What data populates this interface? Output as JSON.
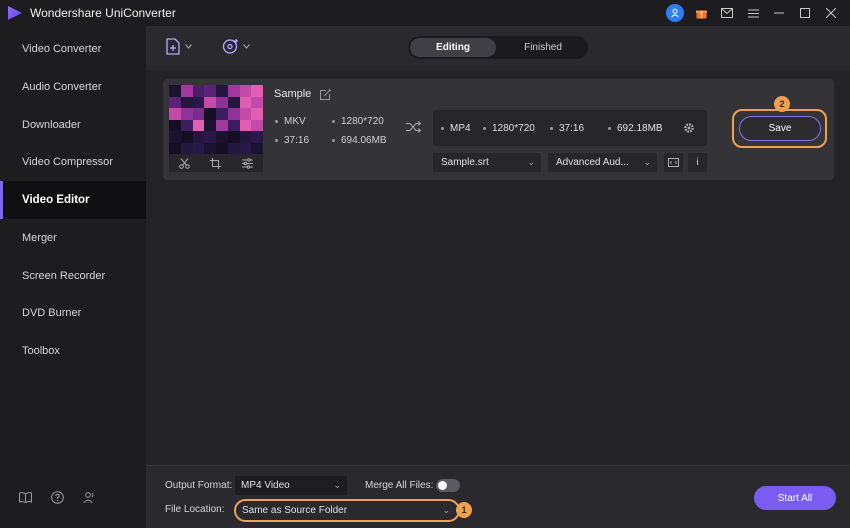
{
  "app": {
    "title": "Wondershare UniConverter"
  },
  "titlebar": {
    "icons": [
      "user-icon",
      "gift-icon",
      "mail-icon",
      "menu-icon",
      "minimize-icon",
      "maximize-icon",
      "close-icon"
    ]
  },
  "sidebar": {
    "items": [
      {
        "label": "Video Converter",
        "active": false
      },
      {
        "label": "Audio Converter",
        "active": false
      },
      {
        "label": "Downloader",
        "active": false
      },
      {
        "label": "Video Compressor",
        "active": false
      },
      {
        "label": "Video Editor",
        "active": true
      },
      {
        "label": "Merger",
        "active": false
      },
      {
        "label": "Screen Recorder",
        "active": false
      },
      {
        "label": "DVD Burner",
        "active": false
      },
      {
        "label": "Toolbox",
        "active": false
      }
    ],
    "footer_icons": [
      "book-icon",
      "help-icon",
      "account-icon"
    ]
  },
  "header": {
    "tabs": [
      {
        "label": "Editing",
        "active": true
      },
      {
        "label": "Finished",
        "active": false
      }
    ]
  },
  "task": {
    "file_name": "Sample",
    "source": {
      "format": "MKV",
      "resolution": "1280*720",
      "duration": "37:16",
      "size": "694.06MB"
    },
    "target": {
      "format": "MP4",
      "resolution": "1280*720",
      "duration": "37:16",
      "size": "692.18MB"
    },
    "subtitle": "Sample.srt",
    "audio": "Advanced Aud...",
    "save_label": "Save",
    "save_badge": "2"
  },
  "bottom": {
    "output_format_label": "Output Format:",
    "output_format_value": "MP4 Video",
    "merge_label": "Merge All Files:",
    "merge_enabled": false,
    "file_location_label": "File Location:",
    "file_location_value": "Same as Source Folder",
    "location_badge": "1",
    "start_all_label": "Start All"
  },
  "colors": {
    "accent": "#7a5cf0",
    "highlight": "#f0a050",
    "sidebar_bg": "#1d1d20",
    "main_bg": "#242428"
  }
}
